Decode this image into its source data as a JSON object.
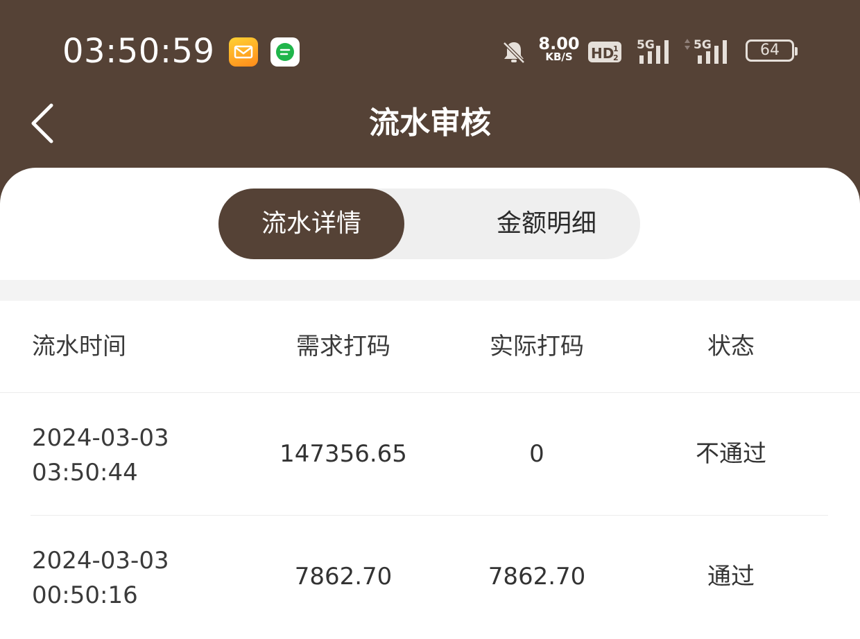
{
  "status_bar": {
    "time": "03:50:59",
    "net_speed_value": "8.00",
    "net_speed_unit": "KB/S",
    "battery": "64",
    "icons": [
      "mail-app-icon",
      "message-app-icon",
      "mute-bell-icon",
      "hd-icon",
      "5g-signal-icon",
      "5g-signal-icon"
    ]
  },
  "header": {
    "title": "流水审核"
  },
  "tabs": [
    {
      "label": "流水详情",
      "active": true
    },
    {
      "label": "金额明细",
      "active": false
    }
  ],
  "table": {
    "columns": [
      "流水时间",
      "需求打码",
      "实际打码",
      "状态"
    ],
    "rows": [
      {
        "date": "2024-03-03",
        "time": "03:50:44",
        "required": "147356.65",
        "actual": "0",
        "status": "不通过"
      },
      {
        "date": "2024-03-03",
        "time": "00:50:16",
        "required": "7862.70",
        "actual": "7862.70",
        "status": "通过"
      }
    ]
  },
  "colors": {
    "header_bg": "#554236",
    "active_tab_bg": "#554236",
    "tab_track_bg": "#efefef"
  }
}
